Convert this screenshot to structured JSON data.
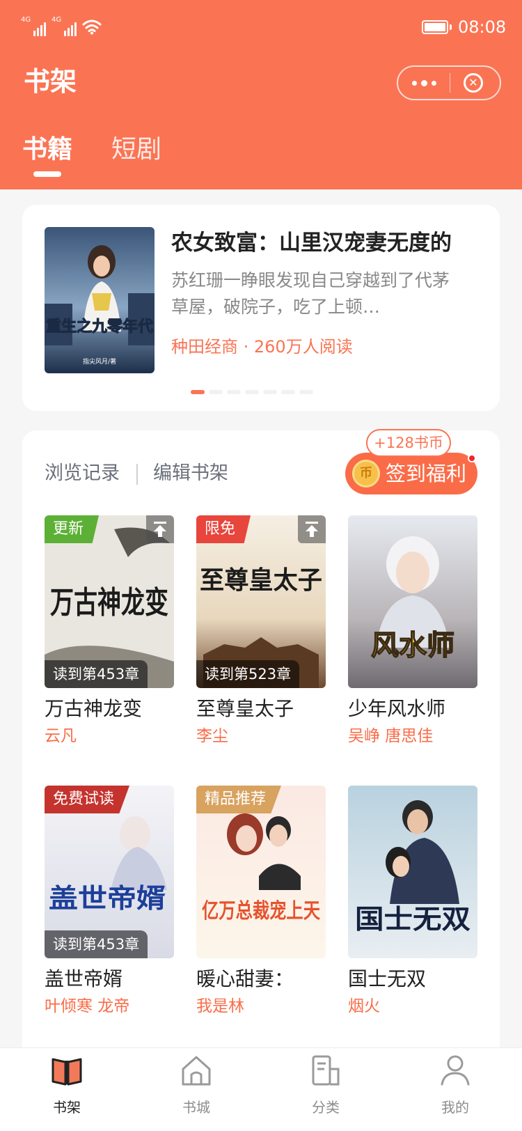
{
  "status_bar": {
    "signal_1": "4G",
    "signal_2": "4G",
    "time": "08:08"
  },
  "header": {
    "title": "书架",
    "tabs": [
      {
        "label": "书籍",
        "active": true
      },
      {
        "label": "短剧",
        "active": false
      }
    ]
  },
  "banner": {
    "cover_title": "重生之九零年代",
    "cover_author": "指尖风月/著",
    "title": "农女致富：山里汉宠妻无度的",
    "description": "苏红珊一睁眼发现自己穿越到了代茅草屋，破院子，吃了上顿…",
    "meta": "种田经商 · 260万人阅读",
    "page_count": 7,
    "active_page": 1
  },
  "shelf": {
    "history_label": "浏览记录",
    "edit_label": "编辑书架",
    "coin_bonus": "+128书币",
    "signin_label": "签到福利",
    "coin_icon_glyph": "币",
    "books": [
      {
        "title": "万古神龙变",
        "author": "云凡",
        "badge": "更新",
        "badge_color": "green",
        "progress": "读到第453章",
        "cover_text": "万古神龙变"
      },
      {
        "title": "至尊皇太子",
        "author": "李尘",
        "badge": "限免",
        "badge_color": "red",
        "progress": "读到第523章",
        "cover_text": "至尊皇太子"
      },
      {
        "title": "少年风水师",
        "author": "吴峥 唐思佳",
        "badge": "",
        "badge_color": "",
        "progress": "",
        "cover_text": "风水师"
      },
      {
        "title": "盖世帝婿",
        "author": "叶倾寒 龙帝",
        "badge": "免费试读",
        "badge_color": "darkred",
        "progress": "读到第453章",
        "cover_text": "盖世帝婿"
      },
      {
        "title": "暖心甜妻：",
        "author": "我是林",
        "badge": "精品推荐",
        "badge_color": "gold",
        "progress": "",
        "cover_text": "亿万总裁宠上天"
      },
      {
        "title": "国士无双",
        "author": "烟火",
        "badge": "",
        "badge_color": "",
        "progress": "",
        "cover_text": "国士无双"
      }
    ]
  },
  "tabbar": [
    {
      "label": "书架",
      "icon": "book-open-icon",
      "active": true
    },
    {
      "label": "书城",
      "icon": "home-icon",
      "active": false
    },
    {
      "label": "分类",
      "icon": "category-icon",
      "active": false
    },
    {
      "label": "我的",
      "icon": "user-icon",
      "active": false
    }
  ],
  "colors": {
    "brand": "#fa7454",
    "accent": "#fa6c48",
    "background": "#f6f6f6"
  }
}
